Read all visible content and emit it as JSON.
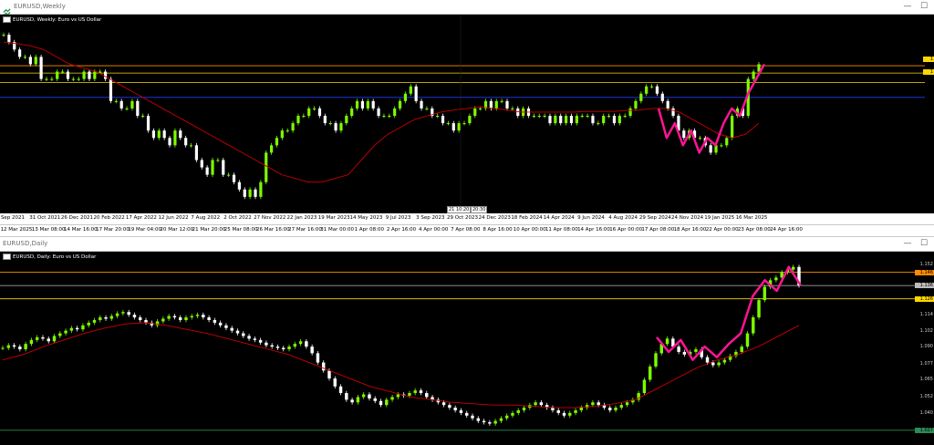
{
  "windows": [
    {
      "title": "EURUSD,Weekly",
      "header": "EURUSD, Weekly: Euro vs US Dollar",
      "buttons": {
        "minimize": "—",
        "maximize": "☐"
      },
      "crosshair_labels": [
        "21 10:20",
        "20:30"
      ],
      "price_labels": [
        {
          "text": "1",
          "color": "#ffd700"
        },
        {
          "text": "1",
          "color": "#ffd700"
        }
      ],
      "date_axis": [
        "Sep 2021",
        "31 Oct 2021",
        "26 Dec 2021",
        "20 Feb 2022",
        "17 Apr 2022",
        "12 Jun 2022",
        "7 Aug 2022",
        "2 Oct 2022",
        "27 Nov 2022",
        "22 Jan 2023",
        "19 Mar 2023",
        "14 May 2023",
        "9 Jul 2023",
        "3 Sep 2023",
        "29 Oct 2023",
        "24 Dec 2023",
        "18 Feb 2024",
        "14 Apr 2024",
        "9 Jun 2024",
        "4 Aug 2024",
        "29 Sep 2024",
        "24 Nov 2024",
        "19 Jan 2025",
        "16 Mar 2025"
      ]
    },
    {
      "title": "EURUSD,Daily",
      "header": "EURUSD, Daily: Euro vs US Dollar",
      "buttons": {
        "minimize": "—",
        "maximize": "☐"
      },
      "top_date_axis": [
        "12 Mar 2025",
        "13 Mar 08:00",
        "14 Mar 16:00",
        "17 Mar 20:00",
        "19 Mar 04:00",
        "20 Mar 12:00",
        "21 Mar 20:00",
        "25 Mar 08:00",
        "26 Mar 16:00",
        "27 Mar 16:00",
        "31 Mar 00:00",
        "1 Apr 08:00",
        "2 Apr 16:00",
        "4 Apr 00:00",
        "7 Apr 08:00",
        "8 Apr 16:00",
        "10 Apr 00:00",
        "11 Apr 08:00",
        "14 Apr 16:00",
        "16 Apr 00:00",
        "17 Apr 08:00",
        "18 Apr 16:00",
        "22 Apr 00:00",
        "23 Apr 08:00",
        "24 Apr 16:00"
      ],
      "price_axis": [
        {
          "text": "1.152",
          "bg": ""
        },
        {
          "text": "1.146",
          "bg": "#ff8c00"
        },
        {
          "text": "1.136",
          "bg": "#bbbbbb"
        },
        {
          "text": "1.126",
          "bg": "#ffd700"
        },
        {
          "text": "1.114",
          "bg": ""
        },
        {
          "text": "1.102",
          "bg": ""
        },
        {
          "text": "1.090",
          "bg": ""
        },
        {
          "text": "1.077",
          "bg": ""
        },
        {
          "text": "1.065",
          "bg": ""
        },
        {
          "text": "1.052",
          "bg": ""
        },
        {
          "text": "1.040",
          "bg": ""
        },
        {
          "text": "1.027",
          "bg": "#2e8b57"
        }
      ]
    }
  ],
  "chart_data": [
    {
      "type": "candlestick",
      "symbol": "EURUSD",
      "timeframe": "Weekly",
      "candle_color_up": "#7cfc00",
      "candle_color_down": "#ffffff",
      "moving_average_color": "#cc0000",
      "overlay_color": "#ff1493",
      "closes": [
        1.19,
        1.18,
        1.17,
        1.16,
        1.16,
        1.15,
        1.16,
        1.13,
        1.13,
        1.13,
        1.14,
        1.14,
        1.13,
        1.13,
        1.13,
        1.14,
        1.13,
        1.14,
        1.14,
        1.13,
        1.1,
        1.1,
        1.09,
        1.09,
        1.1,
        1.08,
        1.08,
        1.06,
        1.05,
        1.06,
        1.05,
        1.04,
        1.06,
        1.05,
        1.04,
        1.04,
        1.02,
        1.01,
        1.0,
        1.02,
        1.02,
        1.0,
        1.0,
        0.99,
        0.98,
        0.97,
        0.98,
        0.97,
        0.99,
        1.03,
        1.04,
        1.05,
        1.06,
        1.06,
        1.07,
        1.08,
        1.08,
        1.09,
        1.09,
        1.08,
        1.07,
        1.07,
        1.06,
        1.07,
        1.08,
        1.09,
        1.1,
        1.09,
        1.1,
        1.09,
        1.08,
        1.08,
        1.08,
        1.09,
        1.1,
        1.11,
        1.12,
        1.1,
        1.09,
        1.09,
        1.08,
        1.08,
        1.07,
        1.07,
        1.06,
        1.07,
        1.07,
        1.08,
        1.09,
        1.09,
        1.1,
        1.09,
        1.1,
        1.1,
        1.09,
        1.09,
        1.08,
        1.09,
        1.08,
        1.08,
        1.08,
        1.08,
        1.07,
        1.08,
        1.07,
        1.08,
        1.07,
        1.08,
        1.08,
        1.08,
        1.07,
        1.07,
        1.08,
        1.08,
        1.07,
        1.08,
        1.08,
        1.09,
        1.1,
        1.11,
        1.12,
        1.12,
        1.11,
        1.1,
        1.09,
        1.08,
        1.06,
        1.05,
        1.06,
        1.05,
        1.05,
        1.04,
        1.03,
        1.04,
        1.04,
        1.05,
        1.08,
        1.09,
        1.08,
        1.13,
        1.14,
        1.15
      ],
      "moving_average": [
        1.18,
        1.178,
        1.175,
        1.17,
        1.16,
        1.15,
        1.145,
        1.14,
        1.13,
        1.12,
        1.11,
        1.1,
        1.09,
        1.08,
        1.07,
        1.06,
        1.05,
        1.04,
        1.03,
        1.02,
        1.01,
        1.0,
        0.995,
        0.99,
        0.99,
        0.995,
        1.0,
        1.02,
        1.04,
        1.055,
        1.065,
        1.075,
        1.08,
        1.085,
        1.088,
        1.09,
        1.092,
        1.09,
        1.088,
        1.085,
        1.085,
        1.085,
        1.085,
        1.085,
        1.086,
        1.086,
        1.086,
        1.087,
        1.088,
        1.09,
        1.09,
        1.085,
        1.075,
        1.065,
        1.055,
        1.05,
        1.055,
        1.07
      ],
      "horizontal_lines": [
        {
          "y": 1.148,
          "color": "#ff8c00"
        },
        {
          "y": 1.138,
          "color": "#ffd700"
        },
        {
          "y": 1.125,
          "color": "#ffd700"
        },
        {
          "y": 1.105,
          "color": "#1e3cff"
        }
      ],
      "overlay_path": [
        1.09,
        1.05,
        1.07,
        1.04,
        1.06,
        1.03,
        1.05,
        1.04,
        1.07,
        1.09,
        1.08,
        1.11,
        1.13,
        1.15
      ]
    },
    {
      "type": "candlestick",
      "symbol": "EURUSD",
      "timeframe": "Daily",
      "candle_color_up": "#7cfc00",
      "candle_color_down": "#ffffff",
      "moving_average_color": "#cc0000",
      "overlay_color": "#ff1493",
      "closes": [
        1.089,
        1.091,
        1.09,
        1.088,
        1.092,
        1.095,
        1.097,
        1.096,
        1.094,
        1.098,
        1.1,
        1.102,
        1.104,
        1.103,
        1.106,
        1.108,
        1.11,
        1.112,
        1.111,
        1.113,
        1.115,
        1.116,
        1.114,
        1.112,
        1.11,
        1.108,
        1.106,
        1.109,
        1.111,
        1.113,
        1.112,
        1.11,
        1.112,
        1.113,
        1.114,
        1.112,
        1.11,
        1.108,
        1.106,
        1.104,
        1.102,
        1.1,
        1.098,
        1.096,
        1.095,
        1.093,
        1.091,
        1.09,
        1.089,
        1.088,
        1.09,
        1.092,
        1.094,
        1.09,
        1.085,
        1.078,
        1.072,
        1.066,
        1.06,
        1.055,
        1.05,
        1.048,
        1.052,
        1.054,
        1.051,
        1.049,
        1.046,
        1.05,
        1.052,
        1.054,
        1.053,
        1.055,
        1.057,
        1.055,
        1.052,
        1.05,
        1.048,
        1.046,
        1.044,
        1.042,
        1.04,
        1.038,
        1.036,
        1.034,
        1.033,
        1.032,
        1.034,
        1.036,
        1.038,
        1.04,
        1.042,
        1.044,
        1.046,
        1.048,
        1.046,
        1.044,
        1.042,
        1.04,
        1.038,
        1.04,
        1.042,
        1.044,
        1.046,
        1.048,
        1.046,
        1.044,
        1.042,
        1.044,
        1.046,
        1.048,
        1.05,
        1.055,
        1.065,
        1.075,
        1.085,
        1.092,
        1.096,
        1.09,
        1.086,
        1.084,
        1.086,
        1.088,
        1.082,
        1.078,
        1.076,
        1.078,
        1.08,
        1.083,
        1.086,
        1.09,
        1.1,
        1.112,
        1.125,
        1.135,
        1.14,
        1.142,
        1.146,
        1.148,
        1.15,
        1.136
      ],
      "moving_average": [
        1.08,
        1.084,
        1.09,
        1.095,
        1.1,
        1.104,
        1.107,
        1.108,
        1.106,
        1.103,
        1.1,
        1.096,
        1.092,
        1.088,
        1.084,
        1.078,
        1.072,
        1.066,
        1.06,
        1.056,
        1.052,
        1.05,
        1.048,
        1.047,
        1.046,
        1.046,
        1.045,
        1.044,
        1.044,
        1.045,
        1.047,
        1.05,
        1.058,
        1.066,
        1.074,
        1.08,
        1.084,
        1.09,
        1.098,
        1.106
      ],
      "horizontal_lines": [
        {
          "y": 1.146,
          "color": "#ff8c00"
        },
        {
          "y": 1.136,
          "color": "#bbbbbb"
        },
        {
          "y": 1.126,
          "color": "#ffd700"
        },
        {
          "y": 1.027,
          "color": "#2e8b57"
        }
      ],
      "overlay_path": [
        1.097,
        1.086,
        1.095,
        1.08,
        1.09,
        1.082,
        1.092,
        1.1,
        1.128,
        1.14,
        1.132,
        1.15,
        1.136
      ],
      "ylim": [
        1.02,
        1.156
      ]
    }
  ]
}
